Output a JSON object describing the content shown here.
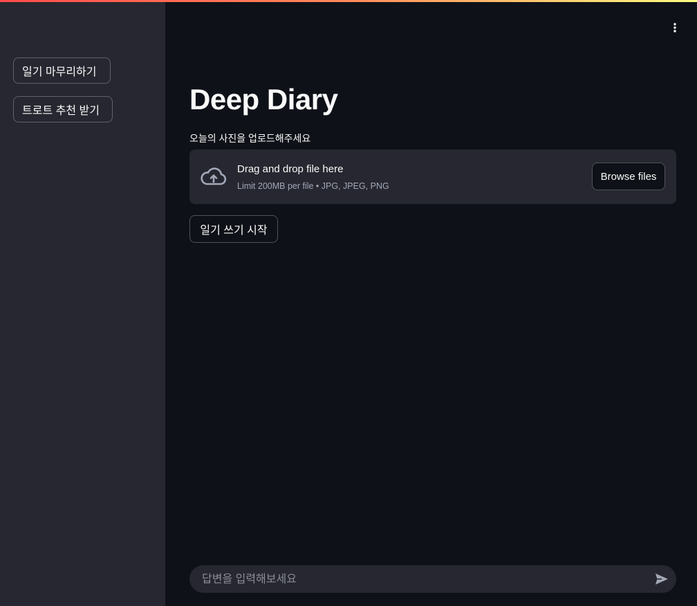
{
  "sidebar": {
    "buttons": [
      {
        "label": "일기 마무리하기"
      },
      {
        "label": "트로트 추천 받기"
      }
    ]
  },
  "header": {
    "menu_icon": "vertical-ellipsis-icon"
  },
  "main": {
    "title": "Deep Diary",
    "upload": {
      "label": "오늘의 사진을 업로드해주세요",
      "drop_title": "Drag and drop file here",
      "drop_subtitle": "Limit 200MB per file • JPG, JPEG, PNG",
      "browse_label": "Browse files",
      "icon": "cloud-upload-icon"
    },
    "start_button": "일기 쓰기 시작"
  },
  "chat": {
    "placeholder": "답변을 입력해보세요",
    "value": "",
    "send_icon": "send-icon"
  },
  "colors": {
    "background": "#0e1117",
    "sidebar": "#262730",
    "text": "#fafafa",
    "muted": "#a3a8b8",
    "accent_gradient": [
      "#ff4b4b",
      "#fffd80"
    ]
  }
}
